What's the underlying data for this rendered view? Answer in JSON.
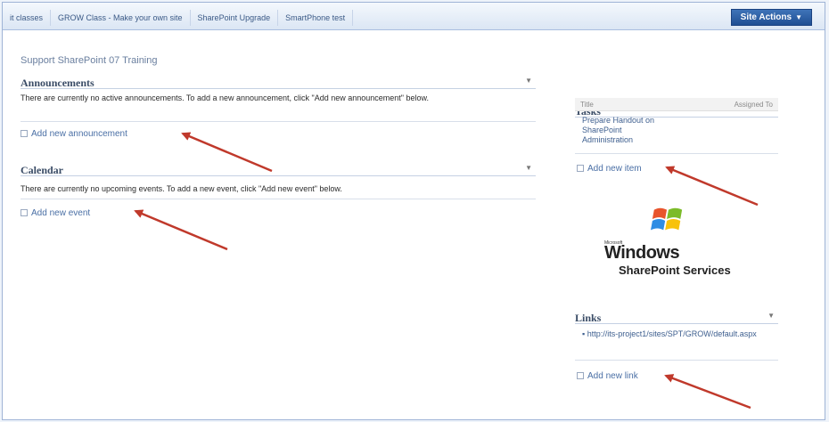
{
  "topnav": {
    "tabs": [
      "it classes",
      "GROW Class - Make your own site",
      "SharePoint Upgrade",
      "SmartPhone test"
    ],
    "site_actions": "Site Actions"
  },
  "page": {
    "title": "Support SharePoint 07 Training"
  },
  "announcements": {
    "title": "Announcements",
    "message": "There are currently no active announcements. To add a new announcement, click \"Add new announcement\" below.",
    "add_link": "Add new announcement"
  },
  "calendar": {
    "title": "Calendar",
    "message": "There are currently no upcoming events. To add a new event, click \"Add new event\" below.",
    "add_link": "Add new event"
  },
  "tasks": {
    "title": "Tasks",
    "col_title": "Title",
    "col_assigned": "Assigned To",
    "items": [
      "Prepare Handout on SharePoint Administration"
    ],
    "add_link": "Add new item"
  },
  "logo": {
    "brand": "Microsoft",
    "line1": "Windows",
    "line2": "SharePoint Services"
  },
  "links": {
    "title": "Links",
    "items": [
      "http://its-project1/sites/SPT/GROW/default.aspx"
    ],
    "add_link": "Add new link"
  },
  "colors": {
    "accent": "#4a6fa5",
    "arrow": "#c0392b",
    "site_actions_bg": "#2a5ea6"
  }
}
